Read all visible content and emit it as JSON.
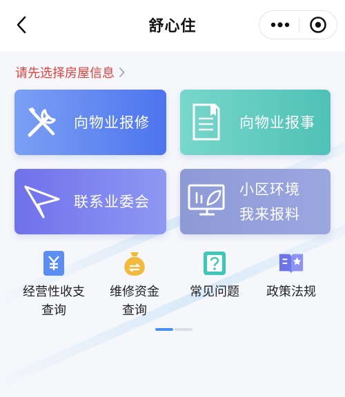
{
  "header": {
    "title": "舒心住",
    "back_icon": "chevron-left-icon",
    "more_icon": "more-dots-icon",
    "close_icon": "target-close-icon"
  },
  "hint": {
    "text": "请先选择房屋信息",
    "color": "#e2403c"
  },
  "cards": [
    {
      "label_lines": [
        "向物业报修"
      ],
      "icon": "wrench-screwdriver-icon",
      "color": "#4d74ee"
    },
    {
      "label_lines": [
        "向物业报事"
      ],
      "icon": "document-list-icon",
      "color": "#4fc1b6"
    },
    {
      "label_lines": [
        "联系业委会"
      ],
      "icon": "paper-plane-icon",
      "color": "#6f71ea"
    },
    {
      "label_lines": [
        "小区环境",
        "我来报料"
      ],
      "icon": "monitor-leaf-icon",
      "color": "#8e9ad6"
    }
  ],
  "quick_actions": [
    {
      "label_lines": [
        "经营性收支",
        "查询"
      ],
      "icon": "yuan-bill-icon",
      "color": "#5b8df2"
    },
    {
      "label_lines": [
        "维修资金",
        "查询"
      ],
      "icon": "money-bag-icon",
      "color": "#f2b93b"
    },
    {
      "label_lines": [
        "常见问题"
      ],
      "icon": "question-card-icon",
      "color": "#3ec7b6"
    },
    {
      "label_lines": [
        "政策法规"
      ],
      "icon": "policy-book-icon",
      "color": "#6c74e8"
    }
  ],
  "pager": {
    "active_index": 0,
    "count": 2,
    "active_color": "#4d8ef4",
    "inactive_color": "#d8dde6"
  }
}
